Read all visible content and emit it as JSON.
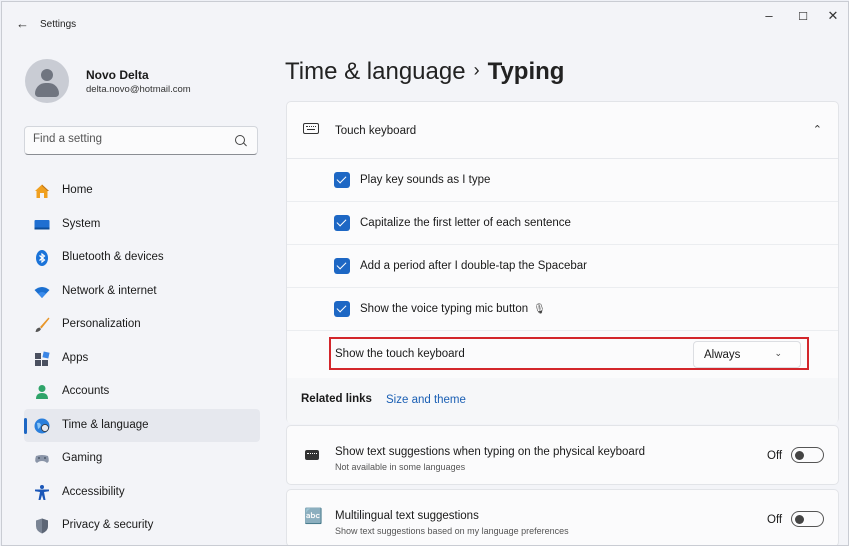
{
  "window": {
    "title": "Settings",
    "back_icon": "←",
    "minimize_icon": "–",
    "maximize_icon": "☐",
    "close_icon": "✕"
  },
  "profile": {
    "name": "Novo Delta",
    "email": "delta.novo@hotmail.com"
  },
  "search": {
    "placeholder": "Find a setting"
  },
  "sidebar": {
    "items": [
      {
        "label": "Home",
        "icon": "home-icon"
      },
      {
        "label": "System",
        "icon": "system-icon"
      },
      {
        "label": "Bluetooth & devices",
        "icon": "bluetooth-icon"
      },
      {
        "label": "Network & internet",
        "icon": "wifi-icon"
      },
      {
        "label": "Personalization",
        "icon": "brush-icon"
      },
      {
        "label": "Apps",
        "icon": "apps-icon"
      },
      {
        "label": "Accounts",
        "icon": "accounts-icon"
      },
      {
        "label": "Time & language",
        "icon": "globe-icon",
        "active": true
      },
      {
        "label": "Gaming",
        "icon": "gamepad-icon"
      },
      {
        "label": "Accessibility",
        "icon": "accessibility-icon"
      },
      {
        "label": "Privacy & security",
        "icon": "shield-icon"
      }
    ]
  },
  "breadcrumb": {
    "parent": "Time & language",
    "separator": "›",
    "current": "Typing"
  },
  "touch_keyboard": {
    "title": "Touch keyboard",
    "expanded": true,
    "options": [
      {
        "label": "Play key sounds as I type",
        "checked": true
      },
      {
        "label": "Capitalize the first letter of each sentence",
        "checked": true
      },
      {
        "label": "Add a period after I double-tap the Spacebar",
        "checked": true
      },
      {
        "label": "Show the voice typing mic button",
        "checked": true
      }
    ],
    "show_touch_keyboard": {
      "label": "Show the touch keyboard",
      "value": "Always"
    },
    "related_links": {
      "label": "Related links",
      "link": "Size and theme"
    }
  },
  "text_suggestions": {
    "title": "Show text suggestions when typing on the physical keyboard",
    "subtitle": "Not available in some languages",
    "state": "Off"
  },
  "multilingual": {
    "title": "Multilingual text suggestions",
    "subtitle": "Show text suggestions based on my language preferences",
    "state": "Off"
  },
  "colors": {
    "accent": "#1d67c4",
    "highlight_border": "#d3262b",
    "link": "#1a5fb4"
  }
}
